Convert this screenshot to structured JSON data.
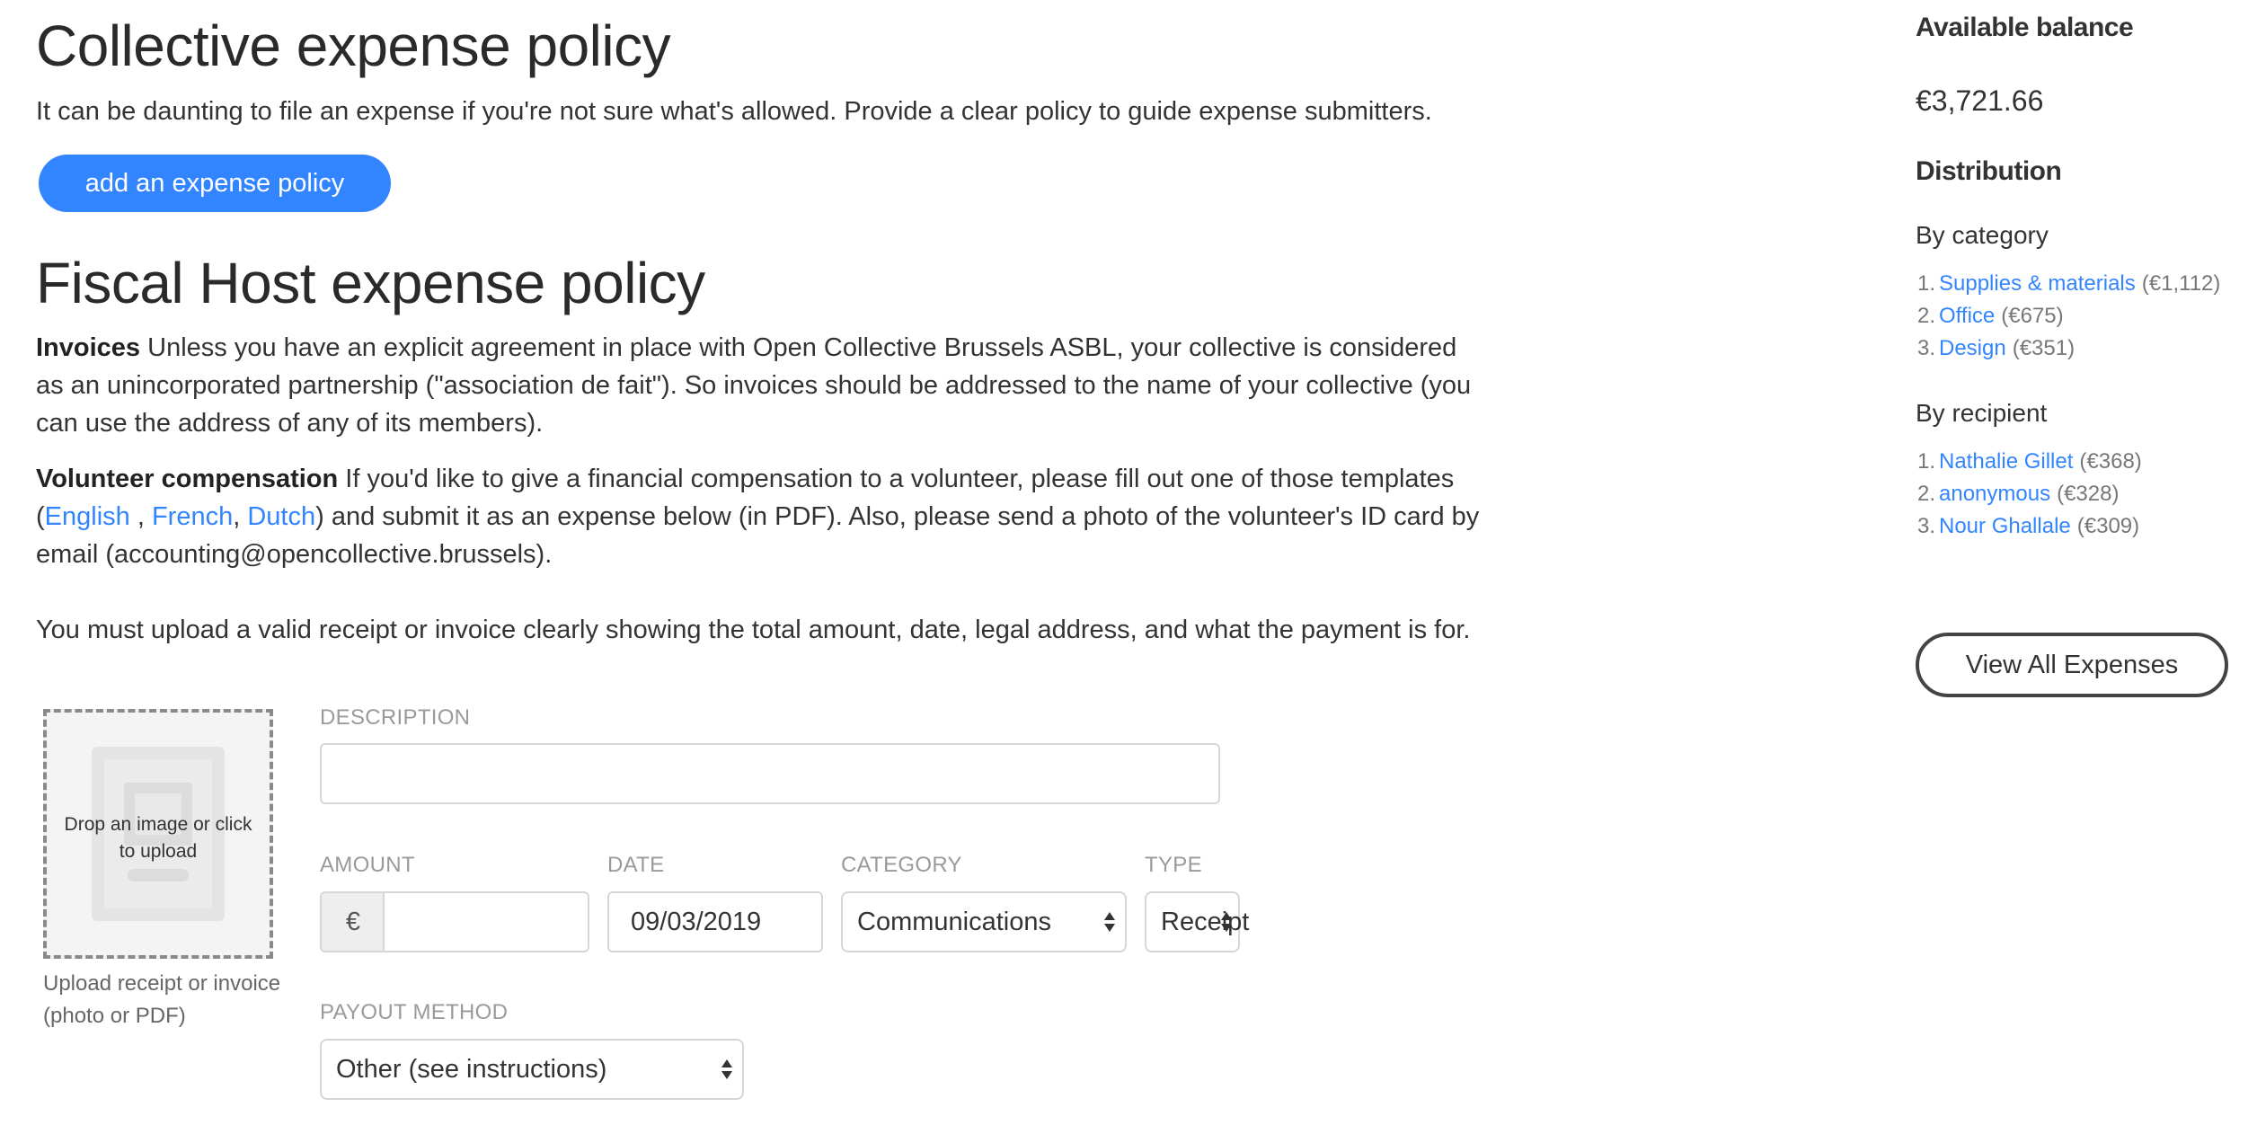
{
  "collective_policy": {
    "title": "Collective expense policy",
    "description": "It can be daunting to file an expense if you're not sure what's allowed. Provide a clear policy to guide expense submitters.",
    "add_button": "add an expense policy"
  },
  "host_policy": {
    "title": "Fiscal Host expense policy",
    "invoices_label": "Invoices",
    "invoices_text": " Unless you have an explicit agreement in place with Open Collective Brussels ASBL, your collective is considered as an unincorporated partnership (\"association de fait\"). So invoices should be addressed to the name of your collective (you can use the address of any of its members).",
    "volunteer_label": "Volunteer compensation",
    "volunteer_text_1": " If you'd like to give a financial compensation to a volunteer, please fill out one of those templates (",
    "link_english": "English",
    "sep_1": " , ",
    "link_french": "French",
    "sep_2": ", ",
    "link_dutch": "Dutch",
    "volunteer_text_2": ") and submit it as an expense below (in PDF). Also, please send a photo of the volunteer's ID card by email (accounting@opencollective.brussels).",
    "receipt_notice": "You must upload a valid receipt or invoice clearly showing the total amount, date, legal address, and what the payment is for."
  },
  "form": {
    "dropzone_text": "Drop an image or click to upload",
    "upload_caption": "Upload receipt or invoice (photo or PDF)",
    "description_label": "DESCRIPTION",
    "description_value": "",
    "amount_label": "AMOUNT",
    "currency_symbol": "€",
    "amount_value": "",
    "date_label": "DATE",
    "date_value": "09/03/2019",
    "category_label": "CATEGORY",
    "category_value": "Communications",
    "type_label": "TYPE",
    "type_value": "Receipt",
    "payout_label": "PAYOUT METHOD",
    "payout_value": "Other (see instructions)"
  },
  "sidebar": {
    "balance_title": "Available balance",
    "balance_value": "€3,721.66",
    "distribution_title": "Distribution",
    "by_category_title": "By category",
    "categories": [
      {
        "num": "1.",
        "name": "Supplies & materials",
        "amount": "(€1,112)"
      },
      {
        "num": "2.",
        "name": "Office",
        "amount": "(€675)"
      },
      {
        "num": "3.",
        "name": "Design",
        "amount": "(€351)"
      }
    ],
    "by_recipient_title": "By recipient",
    "recipients": [
      {
        "num": "1.",
        "name": "Nathalie Gillet",
        "amount": "(€368)"
      },
      {
        "num": "2.",
        "name": "anonymous",
        "amount": "(€328)"
      },
      {
        "num": "3.",
        "name": "Nour Ghallale",
        "amount": "(€309)"
      }
    ],
    "view_all_button": "View All Expenses"
  },
  "colors": {
    "accent": "#3385ff",
    "text": "#333333",
    "muted": "#9a9a9a"
  },
  "icons": {
    "dropzone_placeholder": "document-image-icon",
    "select_caret": "up-down-caret-icon"
  }
}
